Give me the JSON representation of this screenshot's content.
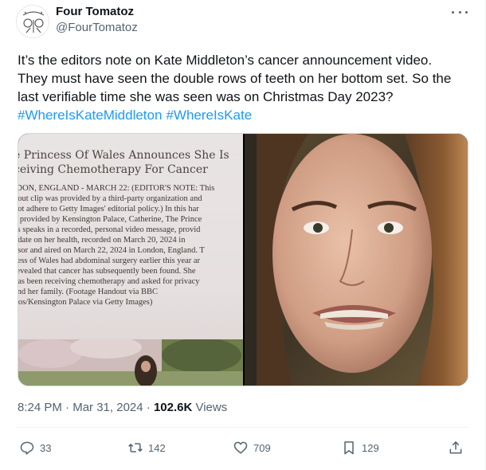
{
  "author": {
    "display_name": "Four Tomatoz",
    "handle": "@FourTomatoz",
    "avatar_icon": "tomato-sketch-icon"
  },
  "tweet": {
    "text_lines": [
      "It’s the editors note on Kate Middleton’s cancer announcement video.",
      "They must have seen the double rows of teeth on her bottom set. So the",
      "last verifiable time she was seen was on Christmas Day 2023?"
    ],
    "hashtags": [
      "#WhereIsKateMiddleton",
      "#WhereIsKate"
    ]
  },
  "media": {
    "left_image": {
      "title_lines": [
        "e Princess Of Wales Announces She Is",
        "ceiving Chemotherapy For Cancer"
      ],
      "body_lines": [
        "IDON, ENGLAND - MARCH 22: (EDITOR'S NOTE: This",
        "dout clip was provided by a third-party organization and",
        "not adhere to Getty Images' editorial policy.) In this har",
        "o provided by Kensington Palace, Catherine, The Prince",
        "es speaks in a recorded, personal video message, provid",
        "pdate on her health, recorded on March 20, 2024 in",
        "dsor and aired on March 22, 2024 in London, England. T",
        "cess of Wales had abdominal surgery earlier this year ar",
        "revealed that cancer has subsequently been found. She",
        "has been receiving chemotherapy and asked for privacy",
        "and her family. (Footage Handout via BBC",
        "lios/Kensington Palace via Getty Images)"
      ]
    }
  },
  "meta": {
    "time": "8:24 PM",
    "separator": " · ",
    "date": "Mar 31, 2024",
    "views_count": "102.6K",
    "views_label": " Views"
  },
  "actions": {
    "reply": {
      "count": "33",
      "icon": "reply-icon"
    },
    "retweet": {
      "count": "142",
      "icon": "retweet-icon"
    },
    "like": {
      "count": "709",
      "icon": "heart-icon"
    },
    "bookmark": {
      "count": "129",
      "icon": "bookmark-icon"
    },
    "share": {
      "icon": "share-icon"
    }
  },
  "colors": {
    "accent": "#1d9bf0",
    "secondary_text": "#536471",
    "primary_text": "#0f1419"
  }
}
